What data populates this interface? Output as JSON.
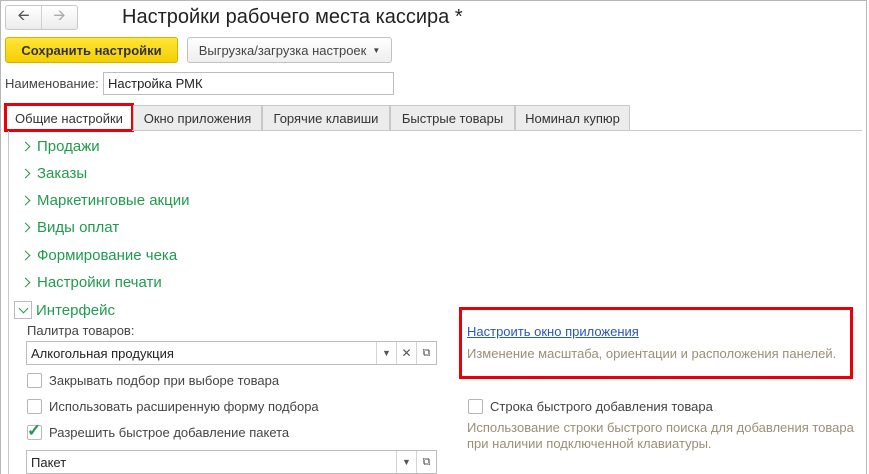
{
  "window": {
    "title": "Настройки рабочего места кассира *"
  },
  "nav": {
    "back_icon": "arrow-left",
    "forward_icon": "arrow-right"
  },
  "toolbar": {
    "save_label": "Сохранить настройки",
    "export_label": "Выгрузка/загрузка настроек"
  },
  "name_field": {
    "label": "Наименование:",
    "value": "Настройка РМК"
  },
  "tabs": [
    {
      "label": "Общие настройки",
      "active": true
    },
    {
      "label": "Окно приложения"
    },
    {
      "label": "Горячие клавиши"
    },
    {
      "label": "Быстрые товары"
    },
    {
      "label": "Номинал купюр"
    }
  ],
  "sections": [
    {
      "label": "Продажи"
    },
    {
      "label": "Заказы"
    },
    {
      "label": "Маркетинговые акции"
    },
    {
      "label": "Виды оплат"
    },
    {
      "label": "Формирование чека"
    },
    {
      "label": "Настройки печати"
    }
  ],
  "interface": {
    "label": "Интерфейс",
    "expanded": true,
    "palette_label": "Палитра товаров:",
    "palette_value": "Алкогольная продукция",
    "checkboxes": [
      {
        "label": "Закрывать подбор при выборе товара",
        "checked": false
      },
      {
        "label": "Использовать расширенную форму подбора",
        "checked": false
      },
      {
        "label": "Разрешить быстрое добавление пакета",
        "checked": true
      }
    ],
    "package_value": "Пакет",
    "window_link": "Настроить окно приложения",
    "window_hint": "Изменение масштаба, ориентации и расположения панелей.",
    "quick_add": {
      "label": "Строка быстрого добавления товара",
      "checked": false,
      "hint1": "Использование строки быстрого поиска для добавления товара",
      "hint2": "при наличии подключенной клавиатуры."
    }
  },
  "colors": {
    "accent_green": "#1f9c4c",
    "save_yellow": "#f4cf00",
    "highlight_red": "#e8000b",
    "link_blue": "#2a56b8"
  }
}
